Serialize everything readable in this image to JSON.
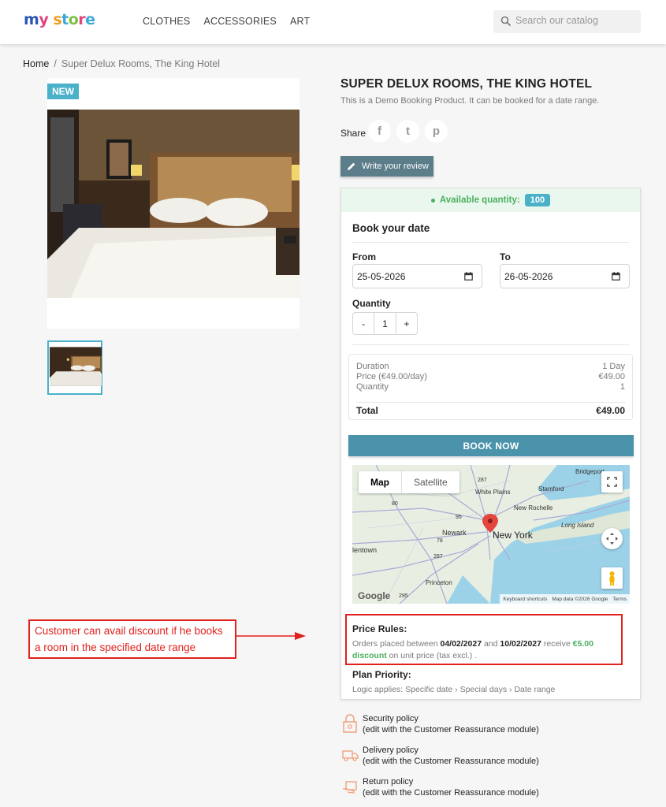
{
  "header": {
    "logo_text": "my store",
    "nav": [
      "CLOTHES",
      "ACCESSORIES",
      "ART"
    ],
    "search_placeholder": "Search our catalog"
  },
  "breadcrumb": {
    "home": "Home",
    "separator": "/",
    "current": "Super Delux Rooms, The King Hotel"
  },
  "product": {
    "badge": "NEW",
    "title": "SUPER DELUX ROOMS, THE KING HOTEL",
    "description": "This is a Demo Booking Product. It can be booked for a date range.",
    "share_label": "Share",
    "social": [
      "f",
      "t",
      "p"
    ],
    "review_button": "Write your review"
  },
  "booking": {
    "available_label": "Available quantity:",
    "available_qty": "100",
    "heading": "Book your date",
    "from_label": "From",
    "to_label": "To",
    "from_value": "25-05-2026",
    "to_value": "26-05-2026",
    "quantity_label": "Quantity",
    "quantity_minus": "-",
    "quantity_value": "1",
    "quantity_plus": "+",
    "summary": {
      "duration_label": "Duration",
      "duration_value": "1 Day",
      "price_label": "Price (€49.00/day)",
      "price_value": "€49.00",
      "quantity_label": "Quantity",
      "quantity_value": "1",
      "total_label": "Total",
      "total_value": "€49.00"
    },
    "book_now": "BOOK NOW"
  },
  "map": {
    "type_map": "Map",
    "type_satellite": "Satellite",
    "labels": [
      "Bridgeport",
      "Stamford",
      "White Plains",
      "New Rochelle",
      "Long Island",
      "Newark",
      "New York",
      "lentown",
      "Princeton",
      "287",
      "80",
      "78",
      "95",
      "287",
      "295"
    ],
    "google": "Google",
    "footer": [
      "Keyboard shortcuts",
      "Map data ©2026 Google",
      "Terms"
    ]
  },
  "price_rules": {
    "heading": "Price Rules:",
    "p1": "Orders placed between ",
    "date1": "04/02/2027",
    "p2": " and ",
    "date2": "10/02/2027",
    "p3": " receive ",
    "discount": "€5.00 discount",
    "p4": " on unit price (tax excl.) ."
  },
  "plan_priority": {
    "heading": "Plan Priority:",
    "text": "Logic applies: Specific date › Special days › Date range"
  },
  "annotation": "Customer can avail discount if he books a room in the specified date range",
  "reassurance": [
    {
      "title": "Security policy",
      "sub": "(edit with the Customer Reassurance module)"
    },
    {
      "title": "Delivery policy",
      "sub": "(edit with the Customer Reassurance module)"
    },
    {
      "title": "Return policy",
      "sub": "(edit with the Customer Reassurance module)"
    }
  ],
  "colors": {
    "accent": "#4bb1c9",
    "book_button": "#4a93ab",
    "success": "#4cb05e",
    "annotation": "#e0211c"
  }
}
